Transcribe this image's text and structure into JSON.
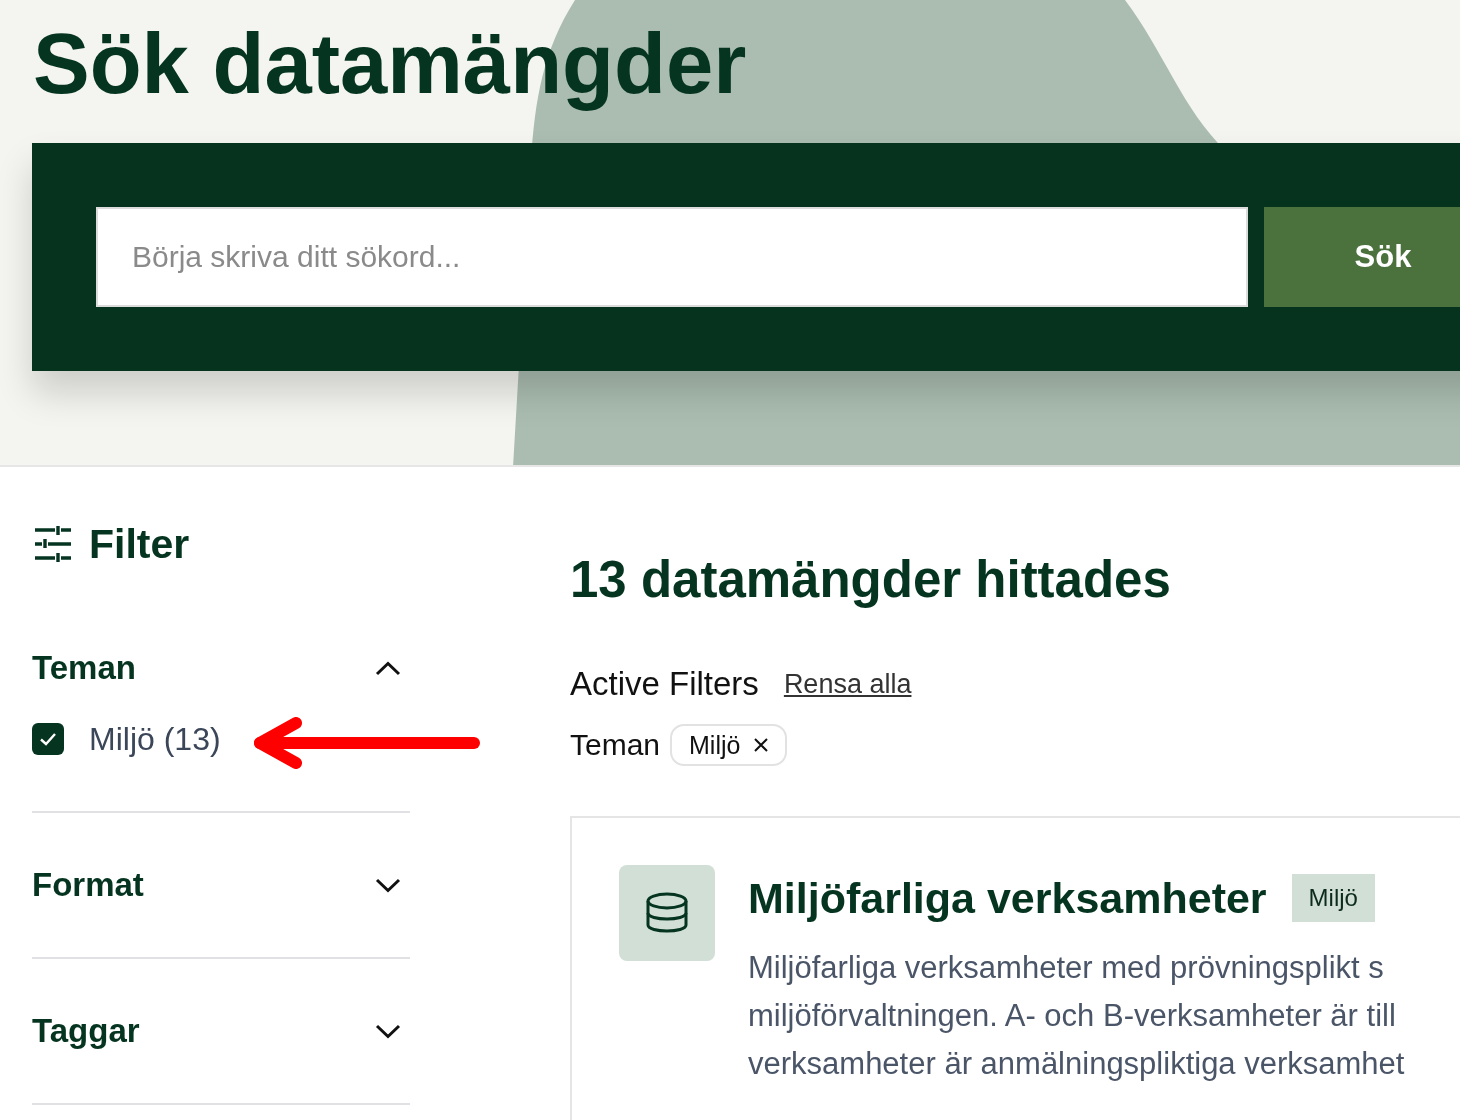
{
  "page": {
    "title": "Sök datamängder"
  },
  "search": {
    "placeholder": "Börja skriva ditt sökord...",
    "button": "Sök"
  },
  "filter_panel": {
    "title": "Filter",
    "groups": [
      {
        "label": "Teman",
        "expanded": true,
        "options": [
          {
            "label": "Miljö (13)",
            "checked": true
          }
        ]
      },
      {
        "label": "Format",
        "expanded": false
      },
      {
        "label": "Taggar",
        "expanded": false
      }
    ]
  },
  "results": {
    "heading": "13 datamängder hittades",
    "active_filters": {
      "label": "Active Filters",
      "clear_link": "Rensa alla",
      "groups": [
        {
          "label": "Teman",
          "chips": [
            "Miljö"
          ]
        }
      ]
    },
    "datasets": [
      {
        "title": "Miljöfarliga verksamheter",
        "tag": "Miljö",
        "description_lines": [
          "Miljöfarliga verksamheter med prövningsplikt s",
          "miljöförvaltningen. A- och B-verksamheter är till",
          "verksamheter är anmälningspliktiga verksamhet"
        ]
      }
    ]
  },
  "annotation": {
    "kind": "arrow"
  }
}
